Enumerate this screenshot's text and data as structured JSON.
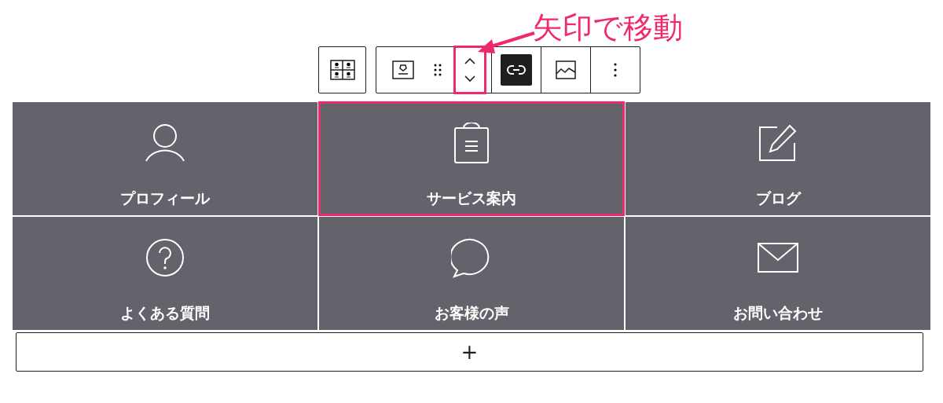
{
  "annotation": {
    "text": "矢印で移動"
  },
  "toolbar": {
    "groups": [
      {
        "sections": [
          [
            {
              "kind": "parent",
              "pressed": false
            }
          ]
        ]
      },
      {
        "sections": [
          [
            {
              "kind": "block-type",
              "pressed": false
            },
            {
              "kind": "drag",
              "pressed": false
            },
            {
              "kind": "movers",
              "pressed": false,
              "highlighted": true
            }
          ],
          [
            {
              "kind": "link",
              "pressed": true
            }
          ],
          [
            {
              "kind": "media",
              "pressed": false
            }
          ],
          [
            {
              "kind": "more",
              "pressed": false
            }
          ]
        ]
      }
    ]
  },
  "grid": {
    "items": [
      {
        "label": "プロフィール",
        "selected": false
      },
      {
        "label": "サービス案内",
        "selected": true
      },
      {
        "label": "ブログ",
        "selected": false
      },
      {
        "label": "よくある質問",
        "selected": false
      },
      {
        "label": "お客様の声",
        "selected": false
      },
      {
        "label": "お問い合わせ",
        "selected": false
      }
    ]
  },
  "add_button": {
    "label": "+"
  }
}
